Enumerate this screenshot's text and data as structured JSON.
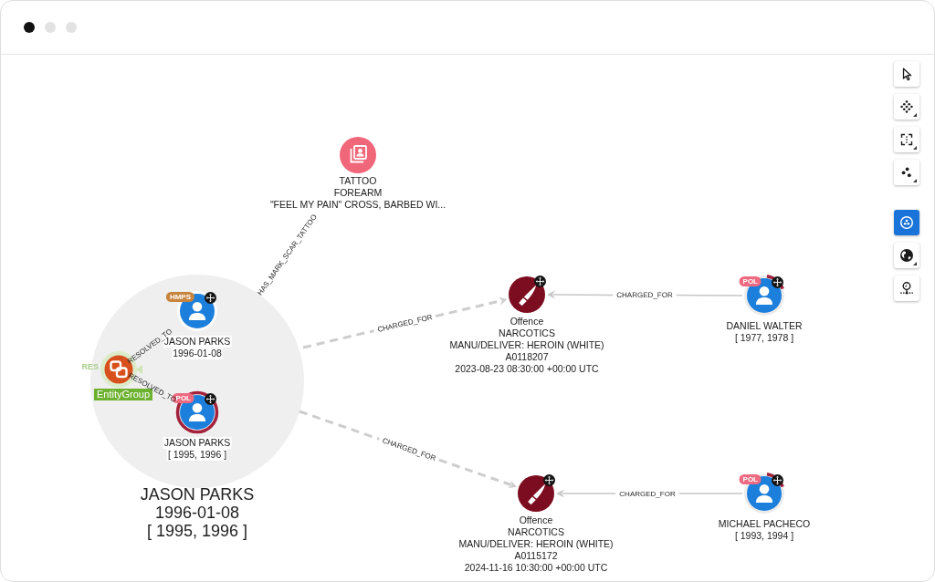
{
  "window": {
    "dots": [
      {
        "selected": true
      },
      {
        "selected": false
      },
      {
        "selected": false
      }
    ]
  },
  "toolbar": {
    "groups": [
      {
        "tools": [
          {
            "kind": "pointer",
            "selected": false,
            "has_menu": false
          },
          {
            "kind": "scatter",
            "selected": false,
            "has_menu": true
          },
          {
            "kind": "frame",
            "selected": false,
            "has_menu": true
          },
          {
            "kind": "cluster",
            "selected": false,
            "has_menu": true
          }
        ]
      },
      {
        "tools": [
          {
            "kind": "group",
            "selected": true,
            "has_menu": false
          },
          {
            "kind": "globe",
            "selected": false,
            "has_menu": true
          },
          {
            "kind": "pin",
            "selected": false,
            "has_menu": false
          }
        ]
      }
    ]
  },
  "graph": {
    "combo": {
      "labels": [
        "JASON PARKS",
        "1996-01-08",
        "[ 1995, 1996 ]"
      ]
    },
    "nodes": [
      {
        "kind": "person",
        "badge": {
          "text": "HMPS",
          "color": "#c8843c"
        },
        "expandable": true,
        "selected": false,
        "flagged": false,
        "labels": [
          "JASON PARKS",
          "1996-01-08"
        ]
      },
      {
        "kind": "person",
        "badge": {
          "text": "POL",
          "color": "#ee6a80"
        },
        "expandable": true,
        "selected": true,
        "flagged": false,
        "labels": [
          "JASON PARKS",
          "[ 1995, 1996 ]"
        ]
      },
      {
        "kind": "entity_group",
        "expandable": false,
        "selected": false,
        "flagged": false,
        "tag": "EntityGroup",
        "faded_label": "RES"
      },
      {
        "kind": "tattoo",
        "expandable": false,
        "selected": false,
        "flagged": false,
        "labels": [
          "TATTOO",
          "FOREARM",
          "\"FEEL MY PAIN\" CROSS, BARBED WI..."
        ]
      },
      {
        "kind": "offence",
        "expandable": true,
        "selected": false,
        "flagged": false,
        "labels": [
          "Offence",
          "NARCOTICS",
          "MANU/DELIVER: HEROIN (WHITE)",
          "A0118207",
          "2023-08-23 08:30:00 +00:00 UTC"
        ]
      },
      {
        "kind": "offence",
        "expandable": true,
        "selected": false,
        "flagged": false,
        "labels": [
          "Offence",
          "NARCOTICS",
          "MANU/DELIVER: HEROIN (WHITE)",
          "A0115172",
          "2024-11-16 10:30:00 +00:00 UTC"
        ]
      },
      {
        "kind": "person",
        "badge": {
          "text": "POL",
          "color": "#ee6a80"
        },
        "expandable": true,
        "selected": false,
        "flagged": true,
        "labels": [
          "DANIEL WALTER",
          "[ 1977, 1978 ]"
        ]
      },
      {
        "kind": "person",
        "badge": {
          "text": "POL",
          "color": "#ee6a80"
        },
        "expandable": true,
        "selected": false,
        "flagged": true,
        "labels": [
          "MICHAEL PACHECO",
          "[ 1993, 1994 ]"
        ]
      }
    ],
    "edges": [
      {
        "kind": "plain",
        "label": "RESOLVED_TO"
      },
      {
        "kind": "plain",
        "label": "RESOLVED_TO"
      },
      {
        "kind": "plain",
        "label": "HAS_MARK_SCAR_TATTOO"
      },
      {
        "kind": "dashed",
        "label": "CHARGED_FOR"
      },
      {
        "kind": "dashed",
        "label": "CHARGED_FOR"
      },
      {
        "kind": "arrow",
        "label": "CHARGED_FOR"
      },
      {
        "kind": "arrow",
        "label": "CHARGED_FOR"
      }
    ]
  }
}
